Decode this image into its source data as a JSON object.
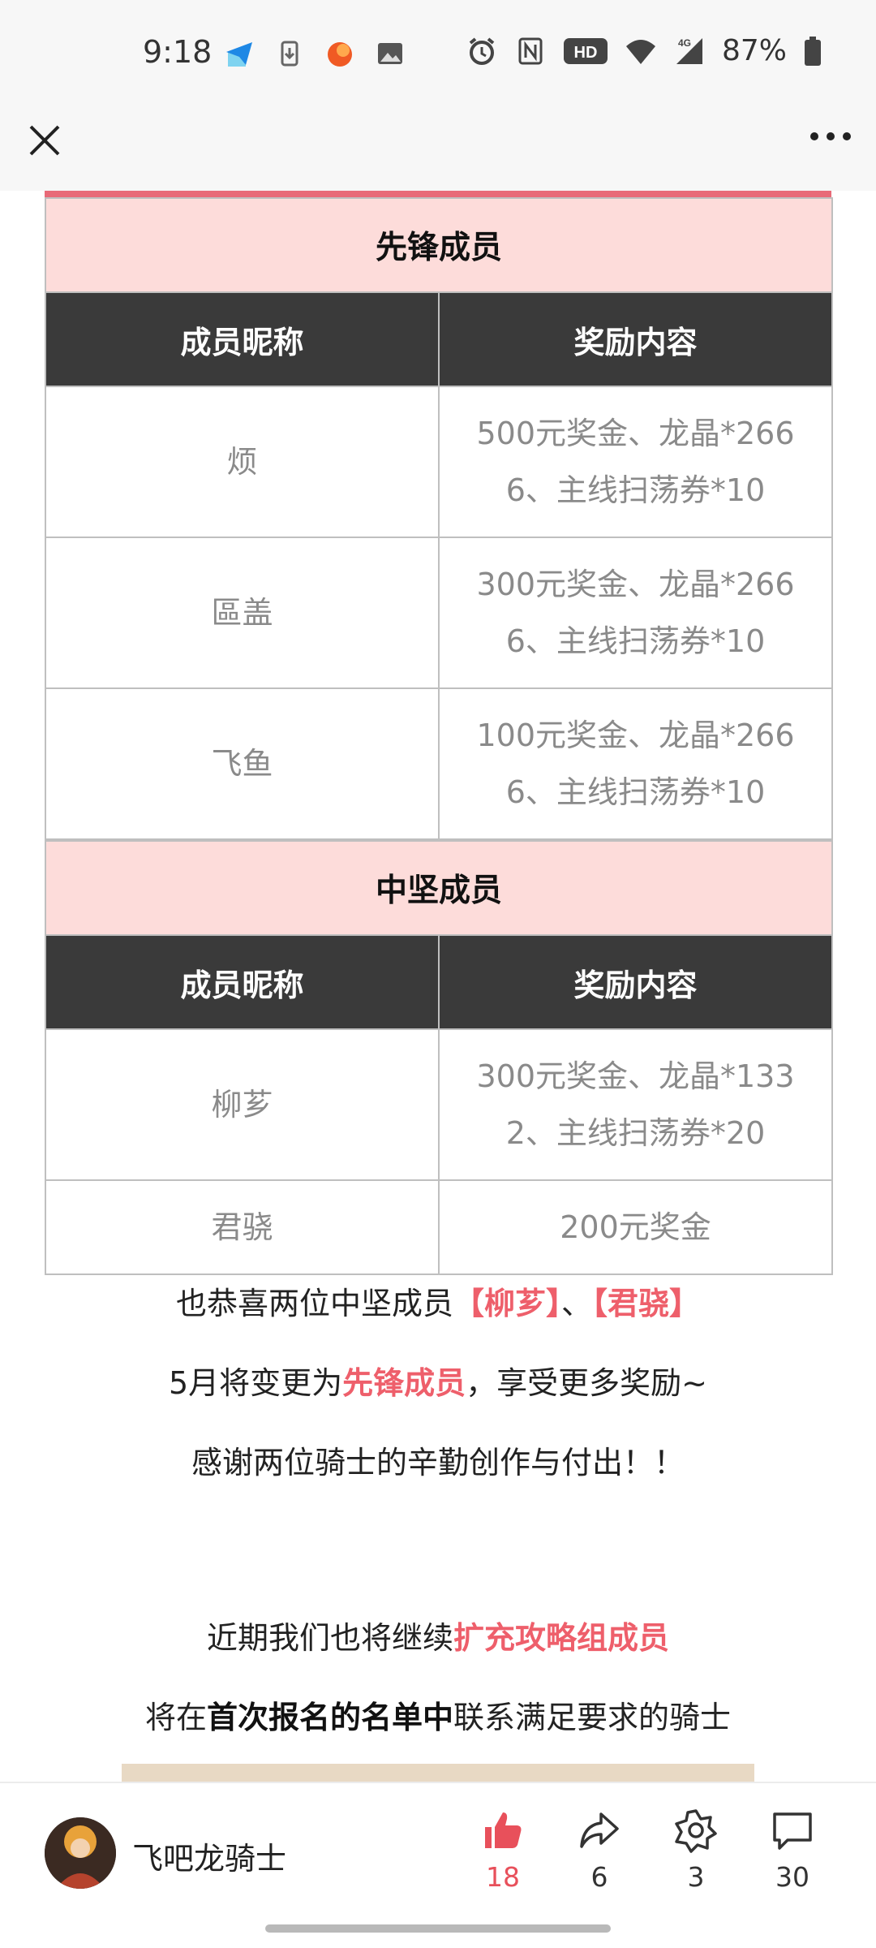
{
  "status_bar": {
    "time": "9:18",
    "battery": "87%",
    "network": "4G",
    "hd_label": "HD",
    "left_icons": [
      "telegram-icon",
      "download-icon",
      "orange-app-icon",
      "image-icon"
    ],
    "right_icons": [
      "alarm-icon",
      "nfc-icon",
      "hd-icon",
      "wifi-icon",
      "signal-icon",
      "battery-icon"
    ]
  },
  "nav": {
    "close_icon": "close-icon",
    "more_icon": "more-icon"
  },
  "tables": [
    {
      "section_title": "先锋成员",
      "headers": [
        "成员昵称",
        "奖励内容"
      ],
      "rows": [
        {
          "name": "烦",
          "reward_line1": "500元奖金、龙晶*266",
          "reward_line2": "6、主线扫荡券*10"
        },
        {
          "name": "區盖",
          "reward_line1": "300元奖金、龙晶*266",
          "reward_line2": "6、主线扫荡券*10"
        },
        {
          "name": "飞鱼",
          "reward_line1": "100元奖金、龙晶*266",
          "reward_line2": "6、主线扫荡券*10"
        }
      ]
    },
    {
      "section_title": "中坚成员",
      "headers": [
        "成员昵称",
        "奖励内容"
      ],
      "rows": [
        {
          "name": "柳芗",
          "reward_line1": "300元奖金、龙晶*133",
          "reward_line2": "2、主线扫荡券*20"
        },
        {
          "name": "君骁",
          "reward_line1": "200元奖金",
          "reward_line2": ""
        }
      ]
    }
  ],
  "paragraphs": {
    "p1_prefix": "也恭喜两位中坚成员",
    "p1_name1": "【柳芗】",
    "p1_sep": "、",
    "p1_name2": "【君骁】",
    "p2_prefix": "5月将变更为",
    "p2_highlight": "先锋成员",
    "p2_suffix": "，享受更多奖励~",
    "p3": "感谢两位骑士的辛勤创作与付出！！",
    "p4_prefix": "近期我们也将继续",
    "p4_highlight": "扩充攻略组成员",
    "p5_prefix": "将在",
    "p5_bold": "首次报名的名单中",
    "p5_suffix": "联系满足要求的骑士"
  },
  "bottom_bar": {
    "author": "飞吧龙骑士",
    "like_count": "18",
    "share_count": "6",
    "collect_count": "3",
    "comment_count": "30",
    "accent_color": "#e8505b"
  }
}
